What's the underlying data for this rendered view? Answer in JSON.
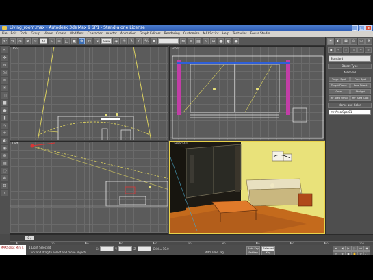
{
  "window": {
    "title": "Living_room.max   - Autodesk 3ds Max 9 SP1  - Stand-alone License",
    "buttons": [
      "_",
      "□",
      "×"
    ]
  },
  "menu": [
    "File",
    "Edit",
    "Tools",
    "Group",
    "Views",
    "Create",
    "Modifiers",
    "Character",
    "reactor",
    "Animation",
    "Graph Editors",
    "Rendering",
    "Customize",
    "MAXScript",
    "Help",
    "Tentacles",
    "Focus Studio"
  ],
  "toolbar": {
    "selection_filter": "All",
    "reference_coord": "View",
    "named_selection": "",
    "icons": [
      "undo-icon",
      "redo-icon",
      "link-icon",
      "unlink-icon",
      "bind-icon",
      "select-icon",
      "select-name-icon",
      "rect-select-icon",
      "window-crossing-icon",
      "move-icon",
      "rotate-icon",
      "scale-icon",
      "pivot-icon",
      "manipulate-icon",
      "snap-icon",
      "angle-snap-icon",
      "percent-snap-icon",
      "spinner-snap-icon",
      "mirror-icon",
      "align-icon",
      "layer-icon",
      "curve-editor-icon",
      "schematic-icon",
      "material-editor-icon",
      "render-setup-icon",
      "render-icon"
    ]
  },
  "viewports": [
    {
      "label": "Top",
      "active": false
    },
    {
      "label": "Front",
      "active": false
    },
    {
      "label": "Left",
      "active": false
    },
    {
      "label": "Camera01",
      "active": true
    }
  ],
  "command_panel": {
    "tabs": [
      "create-tab",
      "modify-tab",
      "hierarchy-tab",
      "motion-tab",
      "display-tab",
      "utilities-tab"
    ],
    "dropdown": "Standard",
    "rollout": "Object Type",
    "autogrid": "AutoGrid",
    "buttons": [
      "Target Spot",
      "Free Spot",
      "Target Direct",
      "Free Direct",
      "Omni",
      "Skylight",
      "mr Area Omni",
      "mr Area Spot"
    ],
    "name_rollout": "Name and Color",
    "name": "mr Area Spot01"
  },
  "timeslider": {
    "label": "0 / 100"
  },
  "ruler": {
    "ticks": [
      "0",
      "10",
      "20",
      "30",
      "40",
      "50",
      "60",
      "70",
      "80",
      "90",
      "100"
    ]
  },
  "status": {
    "maxscript": "MAXScript Mini L",
    "line1": "1 Light Selected",
    "line2": "Click and drag to select and move objects",
    "x_label": "X:",
    "y_label": "Y:",
    "z_label": "Z:",
    "grid": "Grid = 10.0",
    "auto_key": "Auto Key",
    "selected": "Selected",
    "set_key": "Set Key",
    "key_filters": "Key Filters...",
    "add_time_tag": "Add Time Tag"
  },
  "colors": {
    "active_viewport_border": "#e8d24a",
    "wall_yellow": "#e9e27a",
    "floor_orange": "#c46a1c",
    "window_magenta": "#c23ea7"
  }
}
